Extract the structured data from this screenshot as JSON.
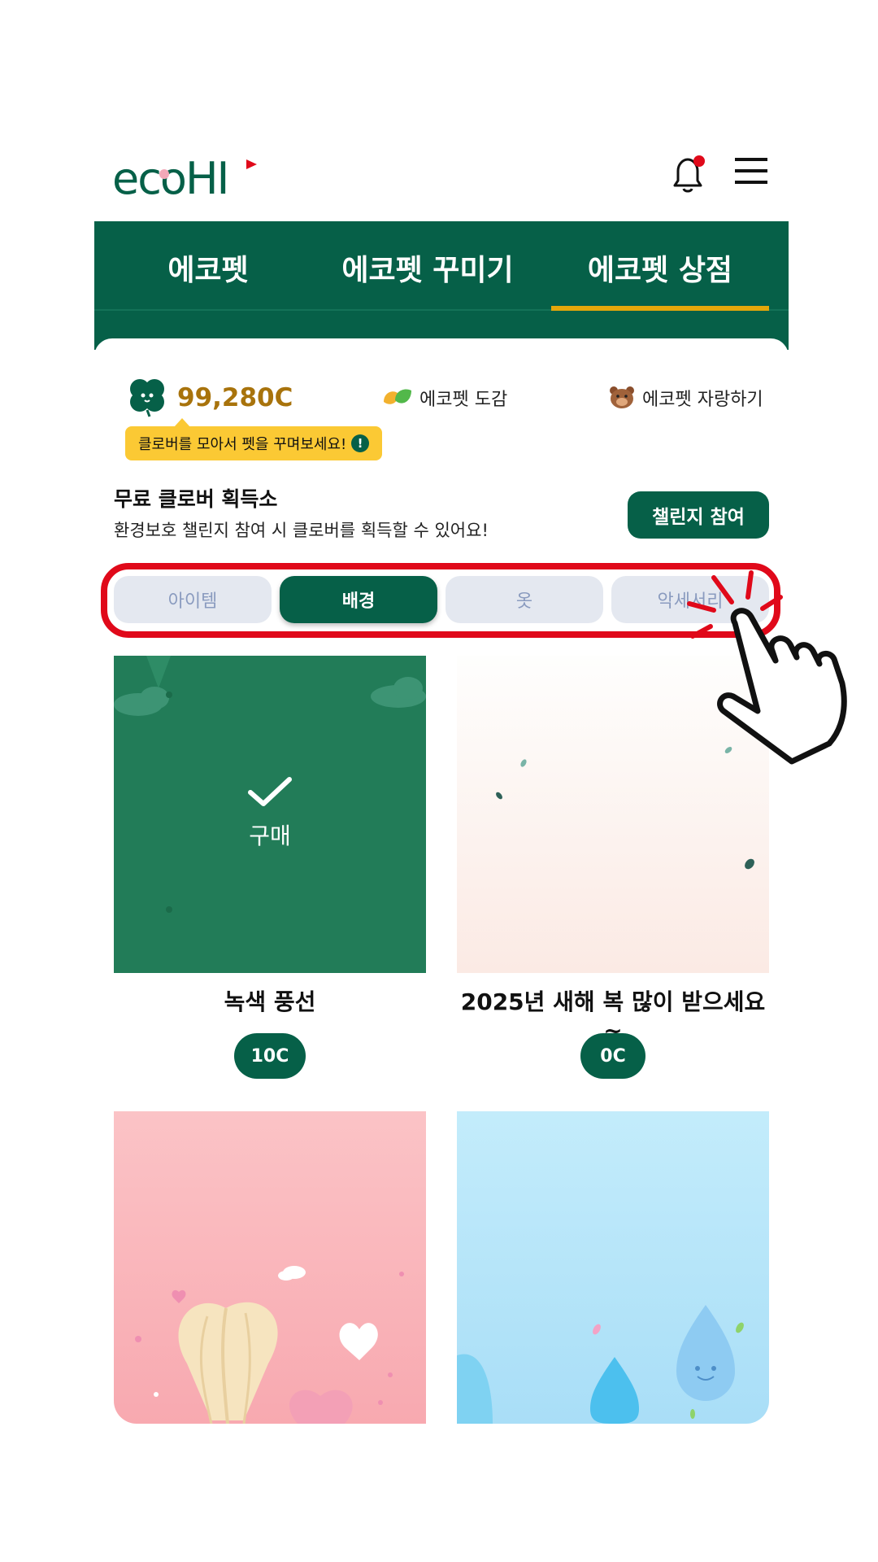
{
  "header": {
    "logo_text": "ecoHI",
    "notification_icon": "bell-icon",
    "menu_icon": "hamburger-menu-icon"
  },
  "tabs": [
    {
      "label": "에코펫",
      "active": false
    },
    {
      "label": "에코펫 꾸미기",
      "active": false
    },
    {
      "label": "에코펫 상점",
      "active": true
    }
  ],
  "status": {
    "balance": "99,280C",
    "dex_label": "에코펫 도감",
    "brag_label": "에코펫 자랑하기",
    "tooltip": "클로버를 모아서 펫을 꾸며보세요!"
  },
  "free_clover": {
    "title": "무료 클로버 획득소",
    "description": "환경보호 챌린지 참여 시 클로버를 획득할 수 있어요!",
    "button": "챌린지 참여"
  },
  "categories": [
    {
      "label": "아이템",
      "selected": false
    },
    {
      "label": "배경",
      "selected": true
    },
    {
      "label": "옷",
      "selected": false
    },
    {
      "label": "악세서리",
      "selected": false
    }
  ],
  "items": [
    {
      "title": "녹색 풍선",
      "price": "10C",
      "purchased_label": "구매"
    },
    {
      "title": "2025년 새해 복 많이 받으세요~",
      "price": "0C"
    },
    {
      "title": "",
      "price": ""
    },
    {
      "title": "",
      "price": ""
    }
  ],
  "colors": {
    "primary": "#066048",
    "accent_gold": "#e4a70a",
    "tooltip_bg": "#fbc934",
    "highlight_red": "#e0091a"
  }
}
